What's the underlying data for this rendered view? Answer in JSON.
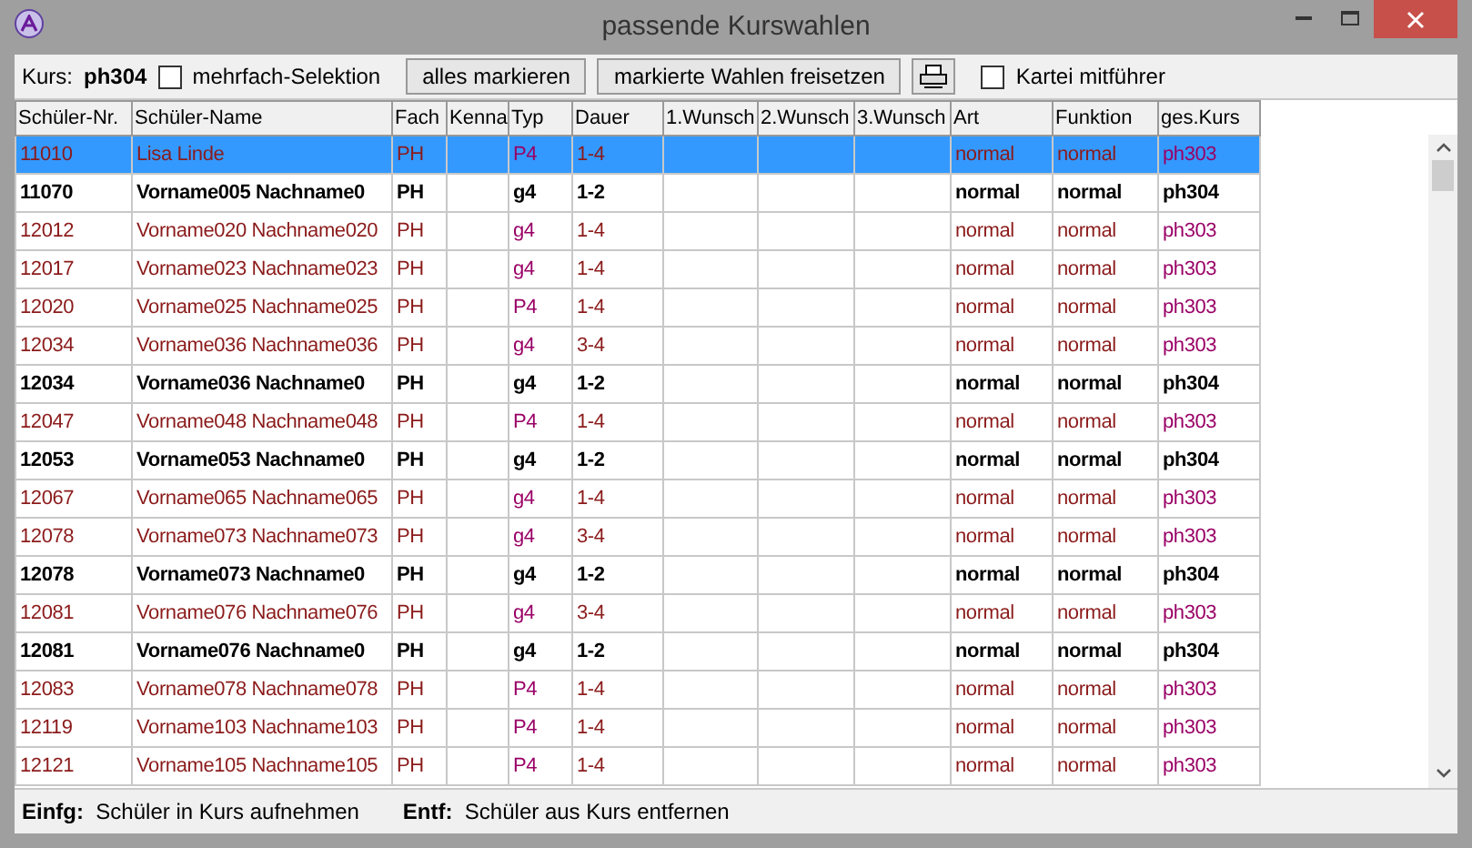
{
  "window": {
    "title": "passende Kurswahlen"
  },
  "toolbar": {
    "course_label": "Kurs:",
    "course": "ph304",
    "multi_select": {
      "label": "mehrfach-Selektion",
      "checked": false
    },
    "buttons": [
      "alles markieren",
      "markierte Wahlen freisetzen"
    ],
    "card_file": {
      "label": "Kartei mitführer",
      "checked": false
    }
  },
  "table": {
    "columns": [
      "Schüler-Nr.",
      "Schüler-Name",
      "Fach",
      "Kenna",
      "Typ",
      "Dauer",
      "1.Wunsch",
      "2.Wunsch",
      "3.Wunsch",
      "Art",
      "Funktion",
      "ges.Kurs"
    ],
    "rows": [
      {
        "selected": true,
        "bold": false,
        "nr": "11010",
        "name": "Lisa Linde",
        "fach": "PH",
        "typ": "P4",
        "dauer": "1-4",
        "art": "normal",
        "funktion": "normal",
        "kurs": "ph303"
      },
      {
        "selected": false,
        "bold": true,
        "nr": "11070",
        "name": "Vorname005 Nachname0",
        "fach": "PH",
        "typ": "g4",
        "dauer": "1-2",
        "art": "normal",
        "funktion": "normal",
        "kurs": "ph304"
      },
      {
        "selected": false,
        "bold": false,
        "nr": "12012",
        "name": "Vorname020 Nachname020",
        "fach": "PH",
        "typ": "g4",
        "dauer": "1-4",
        "art": "normal",
        "funktion": "normal",
        "kurs": "ph303"
      },
      {
        "selected": false,
        "bold": false,
        "nr": "12017",
        "name": "Vorname023 Nachname023",
        "fach": "PH",
        "typ": "g4",
        "dauer": "1-4",
        "art": "normal",
        "funktion": "normal",
        "kurs": "ph303"
      },
      {
        "selected": false,
        "bold": false,
        "nr": "12020",
        "name": "Vorname025 Nachname025",
        "fach": "PH",
        "typ": "P4",
        "dauer": "1-4",
        "art": "normal",
        "funktion": "normal",
        "kurs": "ph303"
      },
      {
        "selected": false,
        "bold": false,
        "nr": "12034",
        "name": "Vorname036 Nachname036",
        "fach": "PH",
        "typ": "g4",
        "dauer": "3-4",
        "art": "normal",
        "funktion": "normal",
        "kurs": "ph303"
      },
      {
        "selected": false,
        "bold": true,
        "nr": "12034",
        "name": "Vorname036 Nachname0",
        "fach": "PH",
        "typ": "g4",
        "dauer": "1-2",
        "art": "normal",
        "funktion": "normal",
        "kurs": "ph304"
      },
      {
        "selected": false,
        "bold": false,
        "nr": "12047",
        "name": "Vorname048 Nachname048",
        "fach": "PH",
        "typ": "P4",
        "dauer": "1-4",
        "art": "normal",
        "funktion": "normal",
        "kurs": "ph303"
      },
      {
        "selected": false,
        "bold": true,
        "nr": "12053",
        "name": "Vorname053 Nachname0",
        "fach": "PH",
        "typ": "g4",
        "dauer": "1-2",
        "art": "normal",
        "funktion": "normal",
        "kurs": "ph304"
      },
      {
        "selected": false,
        "bold": false,
        "nr": "12067",
        "name": "Vorname065 Nachname065",
        "fach": "PH",
        "typ": "g4",
        "dauer": "1-4",
        "art": "normal",
        "funktion": "normal",
        "kurs": "ph303"
      },
      {
        "selected": false,
        "bold": false,
        "nr": "12078",
        "name": "Vorname073 Nachname073",
        "fach": "PH",
        "typ": "g4",
        "dauer": "3-4",
        "art": "normal",
        "funktion": "normal",
        "kurs": "ph303"
      },
      {
        "selected": false,
        "bold": true,
        "nr": "12078",
        "name": "Vorname073 Nachname0",
        "fach": "PH",
        "typ": "g4",
        "dauer": "1-2",
        "art": "normal",
        "funktion": "normal",
        "kurs": "ph304"
      },
      {
        "selected": false,
        "bold": false,
        "nr": "12081",
        "name": "Vorname076 Nachname076",
        "fach": "PH",
        "typ": "g4",
        "dauer": "3-4",
        "art": "normal",
        "funktion": "normal",
        "kurs": "ph303"
      },
      {
        "selected": false,
        "bold": true,
        "nr": "12081",
        "name": "Vorname076 Nachname0",
        "fach": "PH",
        "typ": "g4",
        "dauer": "1-2",
        "art": "normal",
        "funktion": "normal",
        "kurs": "ph304"
      },
      {
        "selected": false,
        "bold": false,
        "nr": "12083",
        "name": "Vorname078 Nachname078",
        "fach": "PH",
        "typ": "P4",
        "dauer": "1-4",
        "art": "normal",
        "funktion": "normal",
        "kurs": "ph303"
      },
      {
        "selected": false,
        "bold": false,
        "nr": "12119",
        "name": "Vorname103 Nachname103",
        "fach": "PH",
        "typ": "P4",
        "dauer": "1-4",
        "art": "normal",
        "funktion": "normal",
        "kurs": "ph303"
      },
      {
        "selected": false,
        "bold": false,
        "nr": "12121",
        "name": "Vorname105 Nachname105",
        "fach": "PH",
        "typ": "P4",
        "dauer": "1-4",
        "art": "normal",
        "funktion": "normal",
        "kurs": "ph303"
      }
    ]
  },
  "status_bar": [
    {
      "key": "Einfg:",
      "text": "Schüler in Kurs aufnehmen"
    },
    {
      "key": "Entf:",
      "text": "Schüler aus Kurs entfernen"
    }
  ]
}
